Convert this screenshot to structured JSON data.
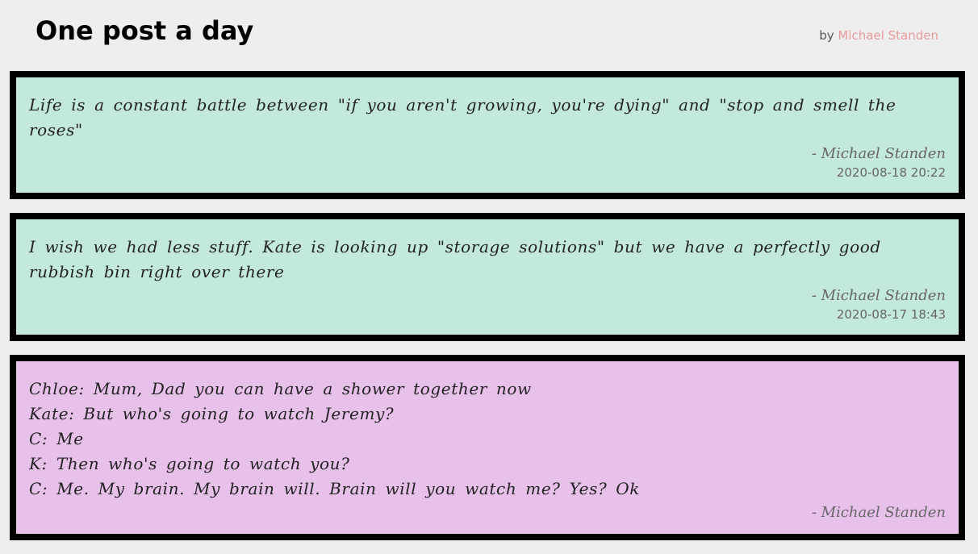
{
  "header": {
    "title": "One post a day",
    "by_prefix": "by",
    "author": "Michael Standen"
  },
  "posts": [
    {
      "text": "Life is a constant battle between \"if you aren't growing, you're dying\" and \"stop and smell the roses\"",
      "author": "- Michael Standen",
      "date": "2020-08-18 20:22",
      "color": "#c2e9da"
    },
    {
      "text": "I wish we had less stuff. Kate is looking up \"storage solutions\" but we have a perfectly good rubbish bin right over there",
      "author": "- Michael Standen",
      "date": "2020-08-17 18:43",
      "color": "#c2e9da"
    },
    {
      "lines": [
        "Chloe: Mum, Dad you can have a shower together now",
        "Kate: But who's going to watch Jeremy?",
        "C: Me",
        "K: Then who's going to watch you?",
        "C: Me. My brain. My brain will. Brain will you watch me? Yes? Ok"
      ],
      "author": "- Michael Standen",
      "color": "#e8c1ea"
    }
  ]
}
